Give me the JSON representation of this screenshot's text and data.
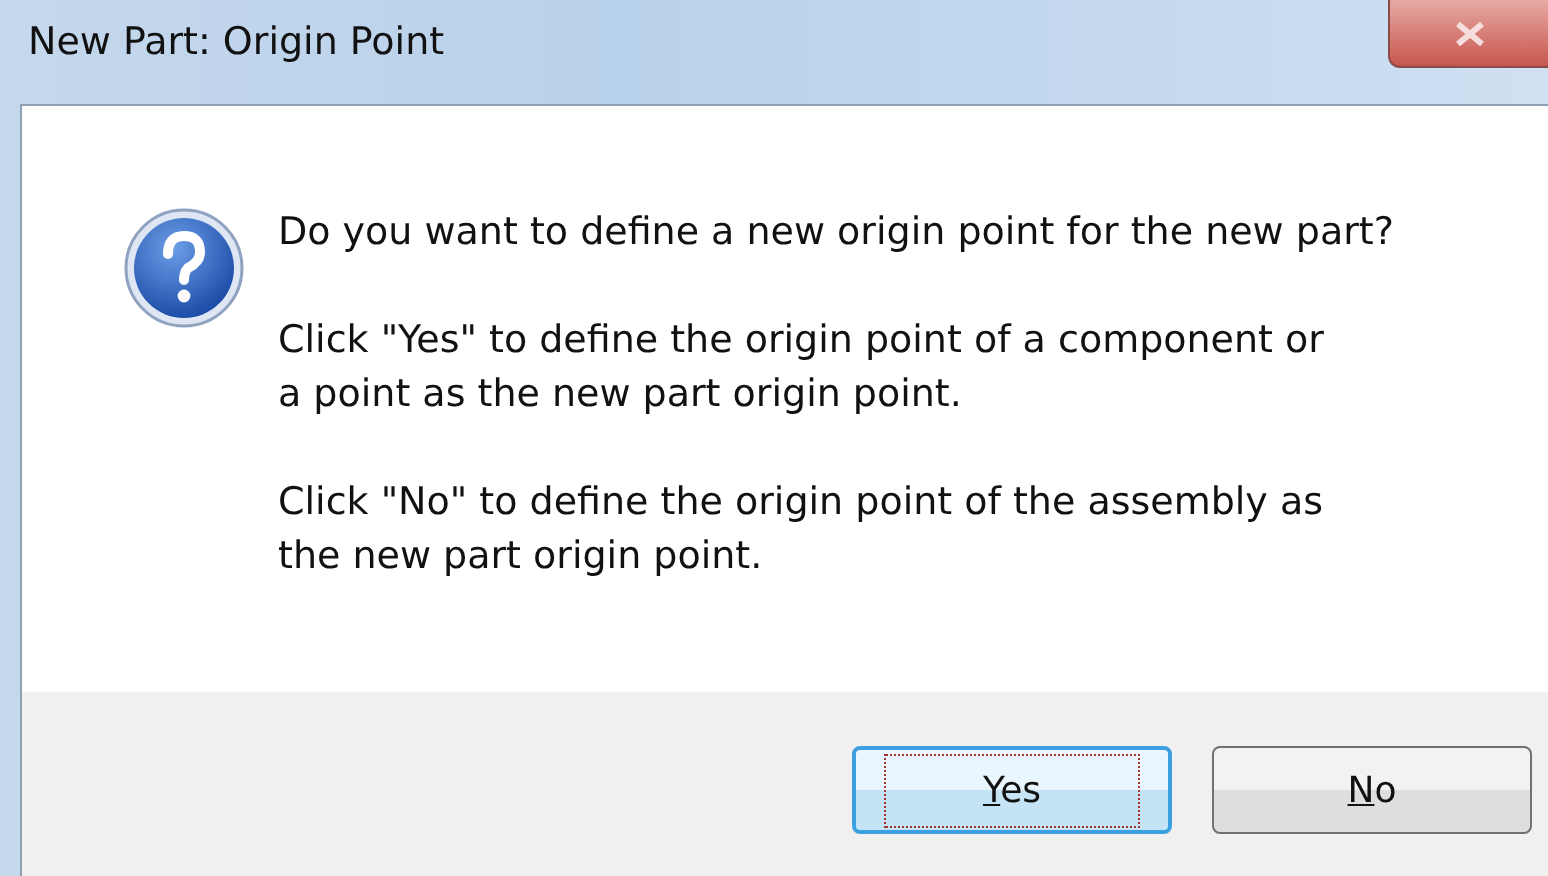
{
  "window": {
    "title": "New Part: Origin Point"
  },
  "message": {
    "question": "Do you want to define a new origin point for the new part?",
    "paragraphs": [
      "Click \"Yes\" to define the origin point of a component or\na point as the new part origin point.",
      "Click \"No\" to define the origin point of the assembly as\nthe new part origin point."
    ]
  },
  "buttons": [
    {
      "label": "Yes",
      "selected": true,
      "mnemonic_first": true
    },
    {
      "label": "No",
      "selected": false,
      "mnemonic_first": true
    }
  ]
}
